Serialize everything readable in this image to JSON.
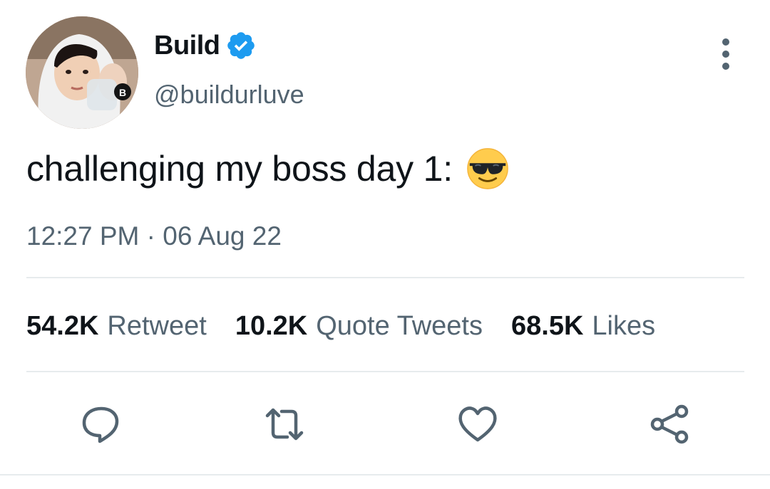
{
  "author": {
    "display_name": "Build",
    "handle": "@buildurluve",
    "verified": true,
    "avatar_icon": "profile-photo",
    "verified_color": "#1d9bf0"
  },
  "tweet": {
    "text": "challenging my boss day 1:",
    "emoji": "smiling-face-with-sunglasses",
    "timestamp": "12:27 PM · 06 Aug 22"
  },
  "stats": {
    "retweets": {
      "count": "54.2K",
      "label": "Retweet"
    },
    "quotes": {
      "count": "10.2K",
      "label": "Quote Tweets"
    },
    "likes": {
      "count": "68.5K",
      "label": "Likes"
    }
  },
  "actions": {
    "reply_icon": "reply-icon",
    "retweet_icon": "retweet-icon",
    "like_icon": "heart-icon",
    "share_icon": "share-icon",
    "more_icon": "more-vertical-icon"
  },
  "colors": {
    "text_primary": "#0f1419",
    "text_secondary": "#536471",
    "divider": "#e7ebed"
  }
}
